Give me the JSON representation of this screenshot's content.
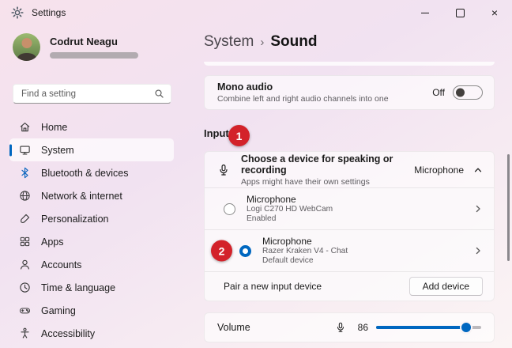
{
  "window": {
    "title": "Settings"
  },
  "titlebar_icons": {
    "close": "×"
  },
  "sidebar": {
    "user": {
      "name": "Codrut Neagu"
    },
    "search_placeholder": "Find a setting",
    "items": [
      {
        "label": "Home"
      },
      {
        "label": "System",
        "selected": true
      },
      {
        "label": "Bluetooth & devices"
      },
      {
        "label": "Network & internet"
      },
      {
        "label": "Personalization"
      },
      {
        "label": "Apps"
      },
      {
        "label": "Accounts"
      },
      {
        "label": "Time & language"
      },
      {
        "label": "Gaming"
      },
      {
        "label": "Accessibility"
      }
    ]
  },
  "breadcrumb": {
    "root": "System",
    "separator": "›",
    "page": "Sound"
  },
  "content": {
    "mono_audio": {
      "title": "Mono audio",
      "description": "Combine left and right audio channels into one",
      "state": "Off"
    },
    "input_section_label": "Input",
    "annotations": {
      "step1": "1",
      "step2": "2"
    },
    "input_device": {
      "title": "Choose a device for speaking or recording",
      "description": "Apps might have their own settings",
      "selected_value": "Microphone",
      "devices": [
        {
          "name": "Microphone",
          "model": "Logi C270 HD WebCam",
          "status": "Enabled"
        },
        {
          "name": "Microphone",
          "model": "Razer Kraken V4 - Chat",
          "status": "Default device"
        }
      ],
      "pair_label": "Pair a new input device",
      "pair_button": "Add device"
    },
    "volume": {
      "label": "Volume",
      "value": "86",
      "fill_style": "width:86%"
    }
  },
  "colors": {
    "accent": "#0067c0",
    "annotation_red": "#d3222a"
  }
}
